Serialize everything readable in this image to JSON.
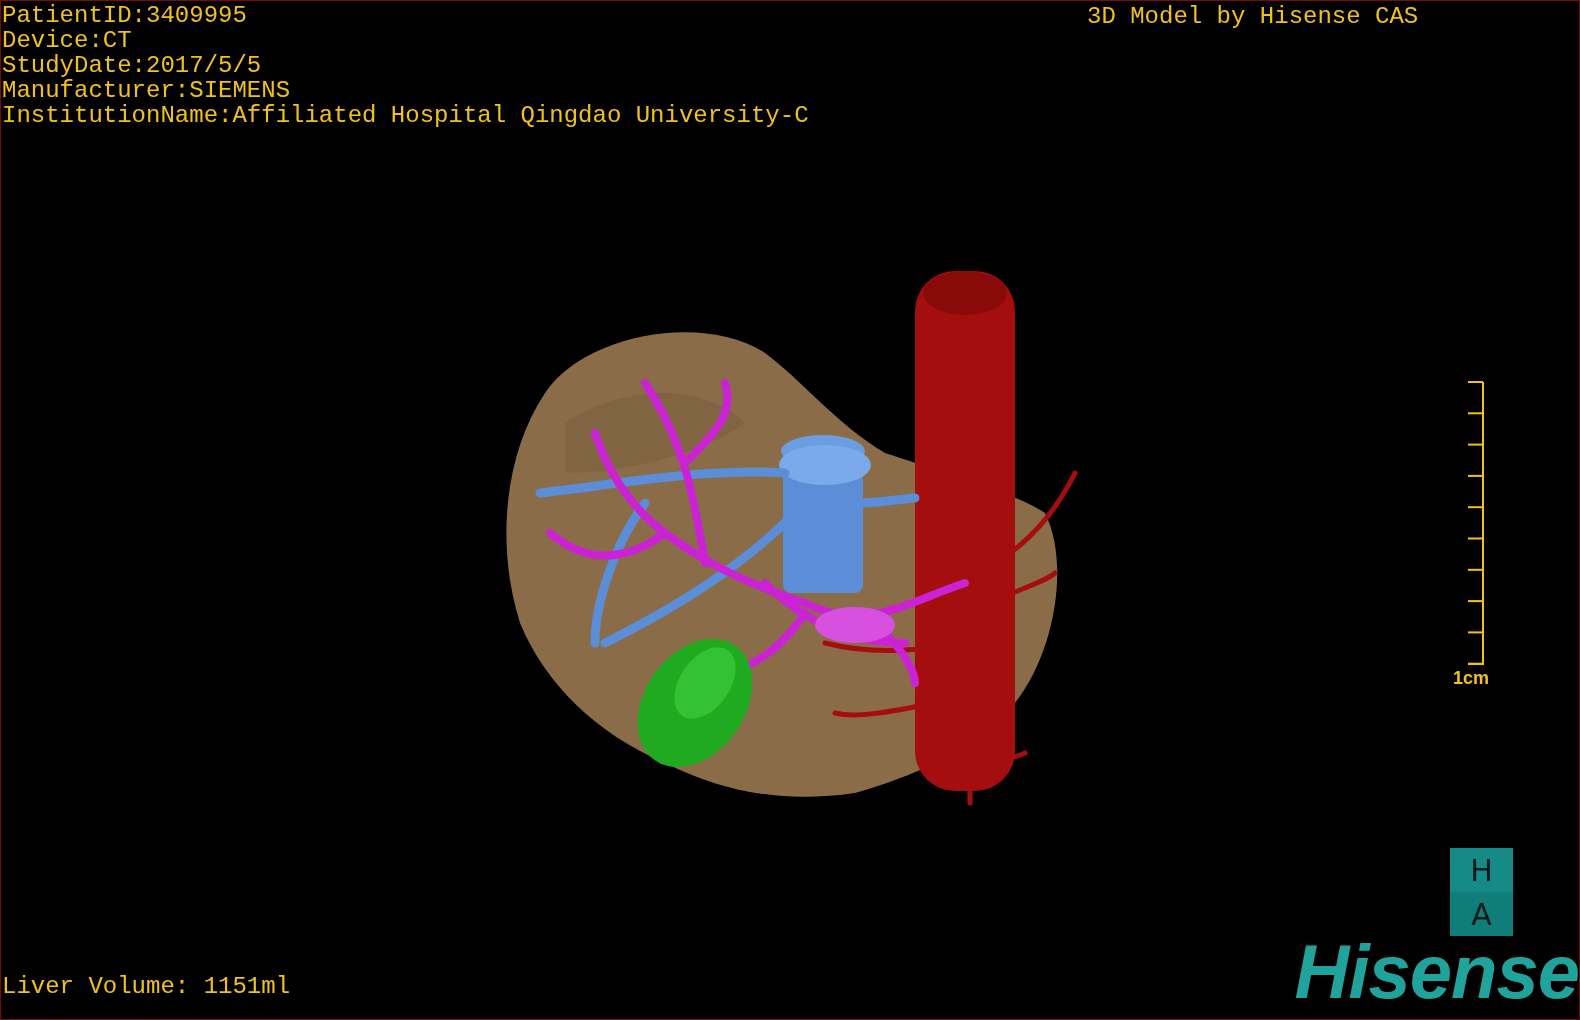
{
  "patient_info": [
    "PatientID:3409995",
    "Device:CT",
    "StudyDate:2017/5/5",
    "Manufacturer:SIEMENS",
    "InstitutionName:Affiliated Hospital Qingdao University-C"
  ],
  "title": "3D Model by Hisense CAS",
  "scale_bar": {
    "label": "1cm"
  },
  "orientation": {
    "top": "H",
    "bottom": "A"
  },
  "liver_volume": "Liver Volume: 1151ml",
  "logo": "Hisense"
}
